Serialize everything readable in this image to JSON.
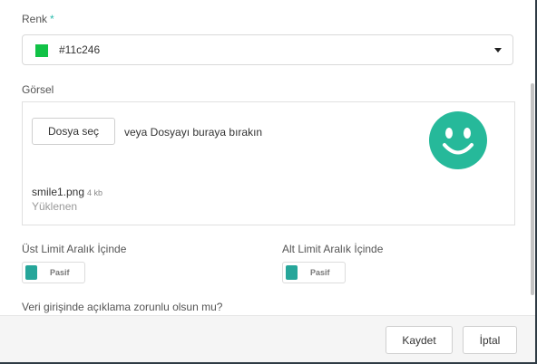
{
  "color_field": {
    "label": "Renk",
    "required_mark": "*",
    "value": "#11c246",
    "swatch_color": "#11c246"
  },
  "image_field": {
    "label": "Görsel",
    "choose_button": "Dosya seç",
    "drop_hint": "veya Dosyayı buraya bırakın",
    "file_name": "smile1.png",
    "file_size": "4 kb",
    "file_status": "Yüklenen",
    "preview_icon": "smiley-face-icon",
    "preview_color": "#26b99a"
  },
  "upper_limit": {
    "label": "Üst Limit Aralık İçinde",
    "toggle_text": "Pasif"
  },
  "lower_limit": {
    "label": "Alt Limit Aralık İçinde",
    "toggle_text": "Pasif"
  },
  "description_required": {
    "label": "Veri girişinde açıklama zorunlu olsun mu?"
  },
  "footer": {
    "save_label": "Kaydet",
    "cancel_label": "İptal"
  }
}
